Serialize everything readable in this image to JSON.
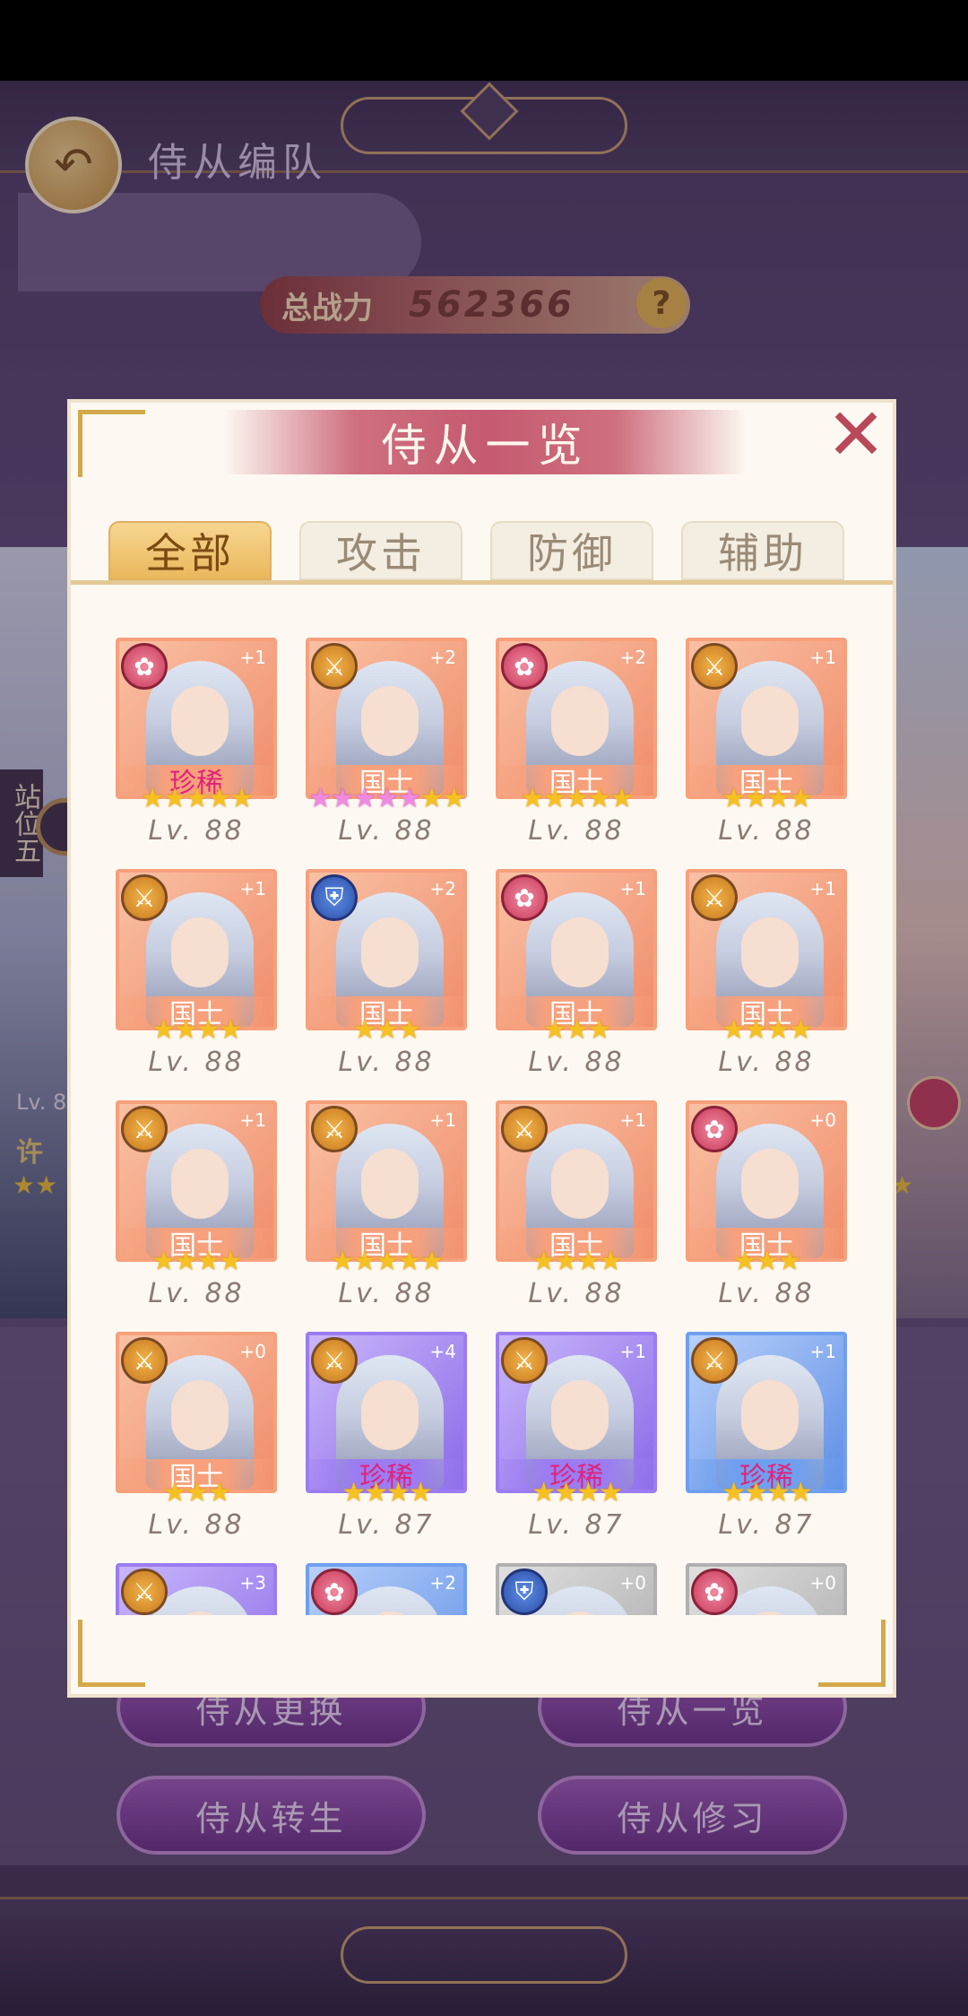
{
  "screen": {
    "title": "侍从编队",
    "power_label": "总战力",
    "power_value": "562366",
    "slot_label": "站位五",
    "left_level": "Lv. 8",
    "left_name": "许",
    "left_stars": "★★",
    "right_stars": "★",
    "under_buttons": [
      "侍从更换",
      "侍从一览",
      "侍从转生",
      "侍从修习"
    ]
  },
  "modal": {
    "title": "侍从一览",
    "close_label": "✕",
    "tabs": [
      {
        "label": "全部",
        "active": true
      },
      {
        "label": "攻击",
        "active": false
      },
      {
        "label": "防御",
        "active": false
      },
      {
        "label": "辅助",
        "active": false
      }
    ],
    "cards": [
      {
        "class": "support",
        "plus": "+1",
        "rank": "珍稀",
        "tier": "orange",
        "stars": 5,
        "pink_stars": 0,
        "level": "Lv. 88"
      },
      {
        "class": "attack",
        "plus": "+2",
        "rank": "国士",
        "tier": "orange",
        "stars": 2,
        "pink_stars": 5,
        "level": "Lv. 88"
      },
      {
        "class": "support",
        "plus": "+2",
        "rank": "国士",
        "tier": "orange",
        "stars": 5,
        "pink_stars": 0,
        "level": "Lv. 88"
      },
      {
        "class": "attack",
        "plus": "+1",
        "rank": "国士",
        "tier": "orange",
        "stars": 4,
        "pink_stars": 0,
        "level": "Lv. 88"
      },
      {
        "class": "attack",
        "plus": "+1",
        "rank": "国士",
        "tier": "orange",
        "stars": 4,
        "pink_stars": 0,
        "level": "Lv. 88"
      },
      {
        "class": "defense",
        "plus": "+2",
        "rank": "国士",
        "tier": "orange",
        "stars": 3,
        "pink_stars": 0,
        "level": "Lv. 88"
      },
      {
        "class": "support",
        "plus": "+1",
        "rank": "国士",
        "tier": "orange",
        "stars": 3,
        "pink_stars": 0,
        "level": "Lv. 88"
      },
      {
        "class": "attack",
        "plus": "+1",
        "rank": "国士",
        "tier": "orange",
        "stars": 4,
        "pink_stars": 0,
        "level": "Lv. 88"
      },
      {
        "class": "attack",
        "plus": "+1",
        "rank": "国士",
        "tier": "orange",
        "stars": 4,
        "pink_stars": 0,
        "level": "Lv. 88"
      },
      {
        "class": "attack",
        "plus": "+1",
        "rank": "国士",
        "tier": "orange",
        "stars": 5,
        "pink_stars": 0,
        "level": "Lv. 88"
      },
      {
        "class": "attack",
        "plus": "+1",
        "rank": "国士",
        "tier": "orange",
        "stars": 4,
        "pink_stars": 0,
        "level": "Lv. 88"
      },
      {
        "class": "support",
        "plus": "+0",
        "rank": "国士",
        "tier": "orange",
        "stars": 3,
        "pink_stars": 0,
        "level": "Lv. 88"
      },
      {
        "class": "attack",
        "plus": "+0",
        "rank": "国士",
        "tier": "orange",
        "stars": 3,
        "pink_stars": 0,
        "level": "Lv. 88"
      },
      {
        "class": "attack",
        "plus": "+4",
        "rank": "珍稀",
        "tier": "purple",
        "stars": 4,
        "pink_stars": 0,
        "level": "Lv. 87"
      },
      {
        "class": "attack",
        "plus": "+1",
        "rank": "珍稀",
        "tier": "purple",
        "stars": 4,
        "pink_stars": 0,
        "level": "Lv. 87"
      },
      {
        "class": "attack",
        "plus": "+1",
        "rank": "珍稀",
        "tier": "blue",
        "stars": 4,
        "pink_stars": 0,
        "level": "Lv. 87"
      },
      {
        "class": "attack",
        "plus": "+3",
        "rank": "",
        "tier": "purple",
        "stars": 0,
        "pink_stars": 0,
        "level": ""
      },
      {
        "class": "support",
        "plus": "+2",
        "rank": "",
        "tier": "blue",
        "stars": 0,
        "pink_stars": 0,
        "level": ""
      },
      {
        "class": "defense",
        "plus": "+0",
        "rank": "",
        "tier": "grey",
        "stars": 0,
        "pink_stars": 0,
        "level": ""
      },
      {
        "class": "support",
        "plus": "+0",
        "rank": "",
        "tier": "grey",
        "stars": 0,
        "pink_stars": 0,
        "level": ""
      }
    ]
  }
}
